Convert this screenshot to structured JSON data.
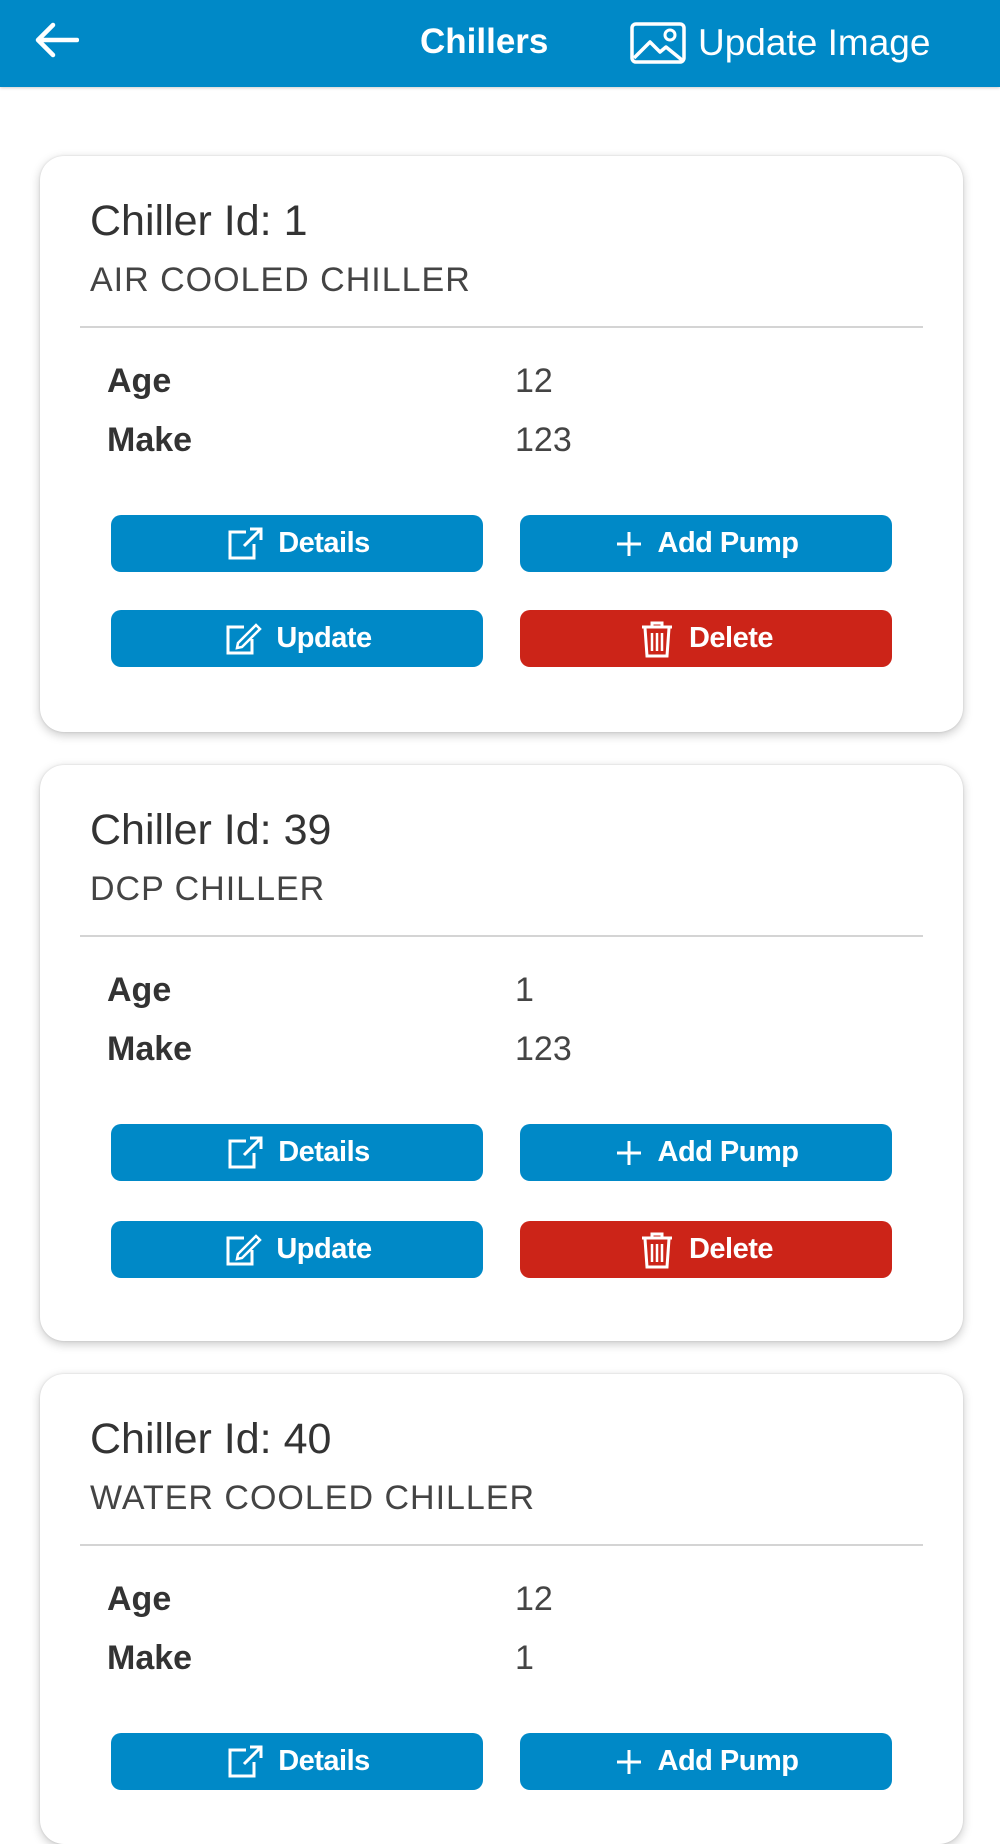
{
  "header": {
    "title": "Chillers",
    "update_image_label": "Update Image",
    "back_icon": "arrow-left-icon",
    "image_icon": "image-icon"
  },
  "field_labels": {
    "age": "Age",
    "make": "Make"
  },
  "buttons": {
    "details": "Details",
    "add_pump": "Add Pump",
    "update": "Update",
    "delete": "Delete"
  },
  "chillers": [
    {
      "title": "Chiller Id: 1",
      "type": "AIR COOLED CHILLER",
      "age": "12",
      "make": "123"
    },
    {
      "title": "Chiller Id: 39",
      "type": "DCP CHILLER",
      "age": "1",
      "make": "123"
    },
    {
      "title": "Chiller Id: 40",
      "type": "WATER COOLED CHILLER",
      "age": "12",
      "make": "1"
    }
  ],
  "colors": {
    "primary": "#0089c7",
    "danger": "#cc2418",
    "background": "#ffffff"
  }
}
